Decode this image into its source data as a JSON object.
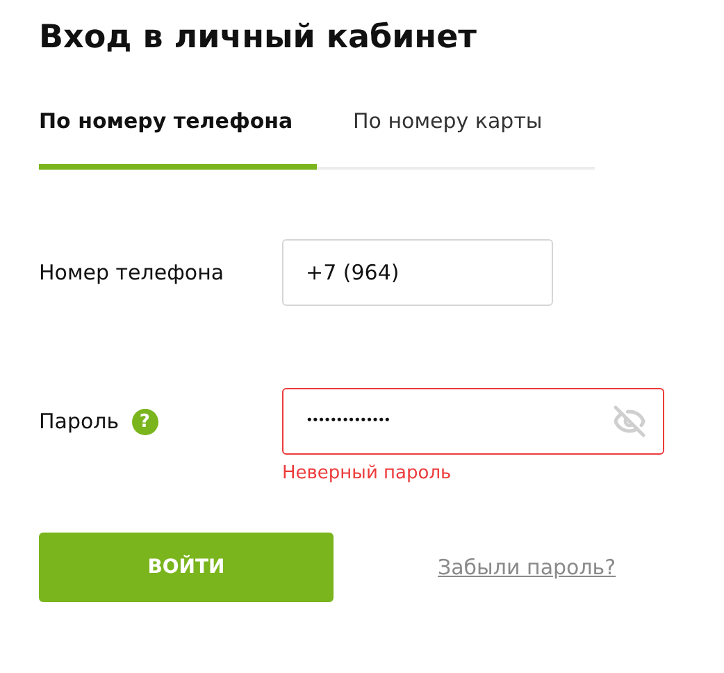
{
  "title": "Вход в личный кабинет",
  "tabs": [
    {
      "label": "По номеру телефона",
      "selected": true
    },
    {
      "label": "По номеру карты",
      "selected": false
    }
  ],
  "fields": [
    {
      "kind": "phone",
      "label": "Номер телефона",
      "value": "+7 (964)",
      "invalid": false
    },
    {
      "kind": "password",
      "label": "Пароль",
      "help": "?",
      "value": "••••••••••••••",
      "invalid": true,
      "error": "Неверный пароль"
    }
  ],
  "submit": "ВОЙТИ",
  "forgot_link": "Забыли пароль?"
}
